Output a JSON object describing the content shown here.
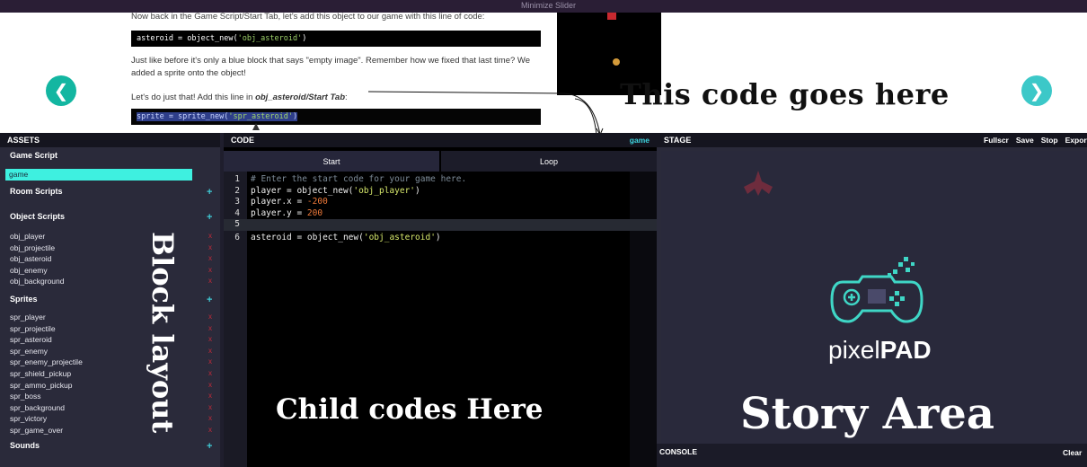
{
  "top_strip": {
    "label": "Minimize Slider"
  },
  "tutorial": {
    "first_line": "Now back in the Game Script/Start Tab, let's add this object to our game with this line of code:",
    "code1_prefix": "asteroid = object_new(",
    "code1_string": "'obj_asteroid'",
    "code1_suffix": ")",
    "para1": "Just like before it's only a blue block that says \"empty image\". Remember how we fixed that last time? We added a sprite onto the object!",
    "para2_prefix": "Let's do just that! Add this line in ",
    "para2_bold": "obj_asteroid/Start Tab",
    "para2_suffix": ":",
    "code2_prefix": "sprite = sprite_new(",
    "code2_string": "'spr_asteroid'",
    "code2_suffix": ")",
    "prev_icon": "chevron-left-icon",
    "next_icon": "chevron-right-icon"
  },
  "annotations": {
    "right": "This code goes here",
    "assets": "Block layout",
    "code": "Child codes Here",
    "stage": "Story Area"
  },
  "assets": {
    "header": "ASSETS",
    "game_script_title": "Game Script",
    "game_item": "game",
    "room_scripts_title": "Room Scripts",
    "object_scripts_title": "Object Scripts",
    "objects": [
      "obj_player",
      "obj_projectile",
      "obj_asteroid",
      "obj_enemy",
      "obj_background"
    ],
    "sprites_title": "Sprites",
    "sprites": [
      "spr_player",
      "spr_projectile",
      "spr_asteroid",
      "spr_enemy",
      "spr_enemy_projectile",
      "spr_shield_pickup",
      "spr_ammo_pickup",
      "spr_boss",
      "spr_background",
      "spr_victory",
      "spr_game_over"
    ],
    "sounds_title": "Sounds",
    "plus": "+",
    "remove": "x"
  },
  "code": {
    "header": "CODE",
    "current_file": "game",
    "tab_start": "Start",
    "tab_loop": "Loop",
    "lines": [
      {
        "n": "1",
        "comment": "# Enter the start code for your game here."
      },
      {
        "n": "2",
        "a": "player = object_new(",
        "s": "'obj_player'",
        "b": ")"
      },
      {
        "n": "3",
        "a": "player.x = ",
        "num": "-200"
      },
      {
        "n": "4",
        "a": "player.y = ",
        "num": "200"
      },
      {
        "n": "5"
      },
      {
        "n": "6",
        "a": "asteroid = object_new(",
        "s": "'obj_asteroid'",
        "b": ")"
      }
    ]
  },
  "stage": {
    "header": "STAGE",
    "buttons": [
      "Fullscr",
      "Save",
      "Stop",
      "Export"
    ],
    "logo_text_light": "pixel",
    "logo_text_bold": "PAD",
    "console_title": "CONSOLE",
    "console_clear": "Clear"
  },
  "colors": {
    "accent_teal": "#13b6a1",
    "ide_background": "#1f1e2d",
    "selected_game": "#3ef0e0",
    "remove_red": "#c42a3a"
  }
}
